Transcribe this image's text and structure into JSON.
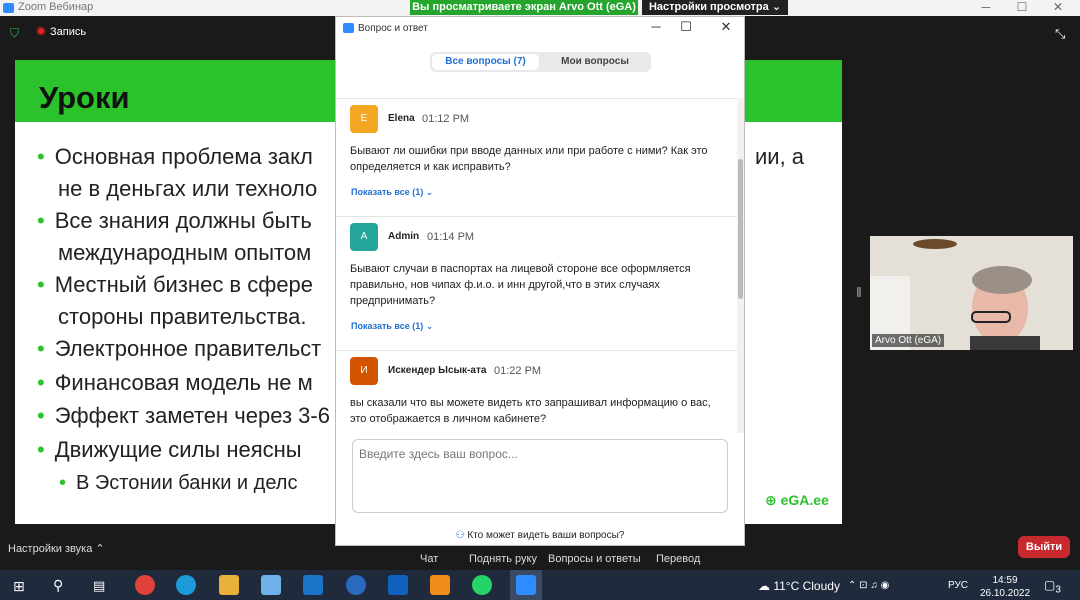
{
  "window": {
    "title": "Zoom Вебинар",
    "minimize": "─",
    "maximize": "☐",
    "close": "✕"
  },
  "share_banner": "Вы просматриваете экран Arvo Ott (eGA)",
  "view_options": "Настройки просмотра",
  "recording": "Запись",
  "slide": {
    "title": "Уроки",
    "bullets": [
      "Основная проблема закл",
      "не в деньгах или техноло",
      "Все знания должны быть",
      "международным опытом",
      "Местный бизнес в сфере",
      "стороны правительства.",
      "Электронное правительст",
      "Финансовая модель не м",
      "Эффект заметен через 3-6",
      "Движущие силы неясны",
      "В Эстонии банки и делс"
    ],
    "right_fragments": [
      "ии, а"
    ],
    "logo": "eGA.ee"
  },
  "video": {
    "name": "Arvo Ott (eGA)"
  },
  "qa": {
    "title": "Вопрос и ответ",
    "tab_all": "Все вопросы (7)",
    "tab_mine": "Мои вопросы",
    "questions": [
      {
        "initial": "E",
        "name": "Elena",
        "time": "01:12 PM",
        "text": "Бывают ли ошибки при вводе данных или при работе с ними? Как это определяется и как исправить?",
        "show": "Показать все (1) ⌄",
        "color": "#f5a623"
      },
      {
        "initial": "A",
        "name": "Admin",
        "time": "01:14 PM",
        "text": "Бывают случаи в паспортах на лицевой стороне все оформляется правильно, нов чипах ф.и.о. и инн другой,что в этих случаях предпринимать?",
        "show": "Показать все (1) ⌄",
        "color": "#26a69a"
      },
      {
        "initial": "И",
        "name": "Искендер Ысык-ата",
        "time": "01:22 PM",
        "text": "вы сказали что вы можете видеть кто запрашивал информацию о вас, это отображается в личном кабинете?",
        "show": "",
        "color": "#d35400"
      }
    ],
    "input_placeholder": "Введите здесь ваш вопрос...",
    "who_can_see": "Кто может видеть ваши вопросы?"
  },
  "bottom": {
    "sound": "Настройки звука",
    "chat": "Чат",
    "raise_hand": "Поднять руку",
    "qa": "Вопросы и ответы",
    "translate": "Перевод",
    "leave": "Выйти"
  },
  "taskbar": {
    "weather": "11°C  Cloudy",
    "lang": "РУС",
    "time": "14:59",
    "date": "26.10.2022",
    "notif": "3"
  }
}
